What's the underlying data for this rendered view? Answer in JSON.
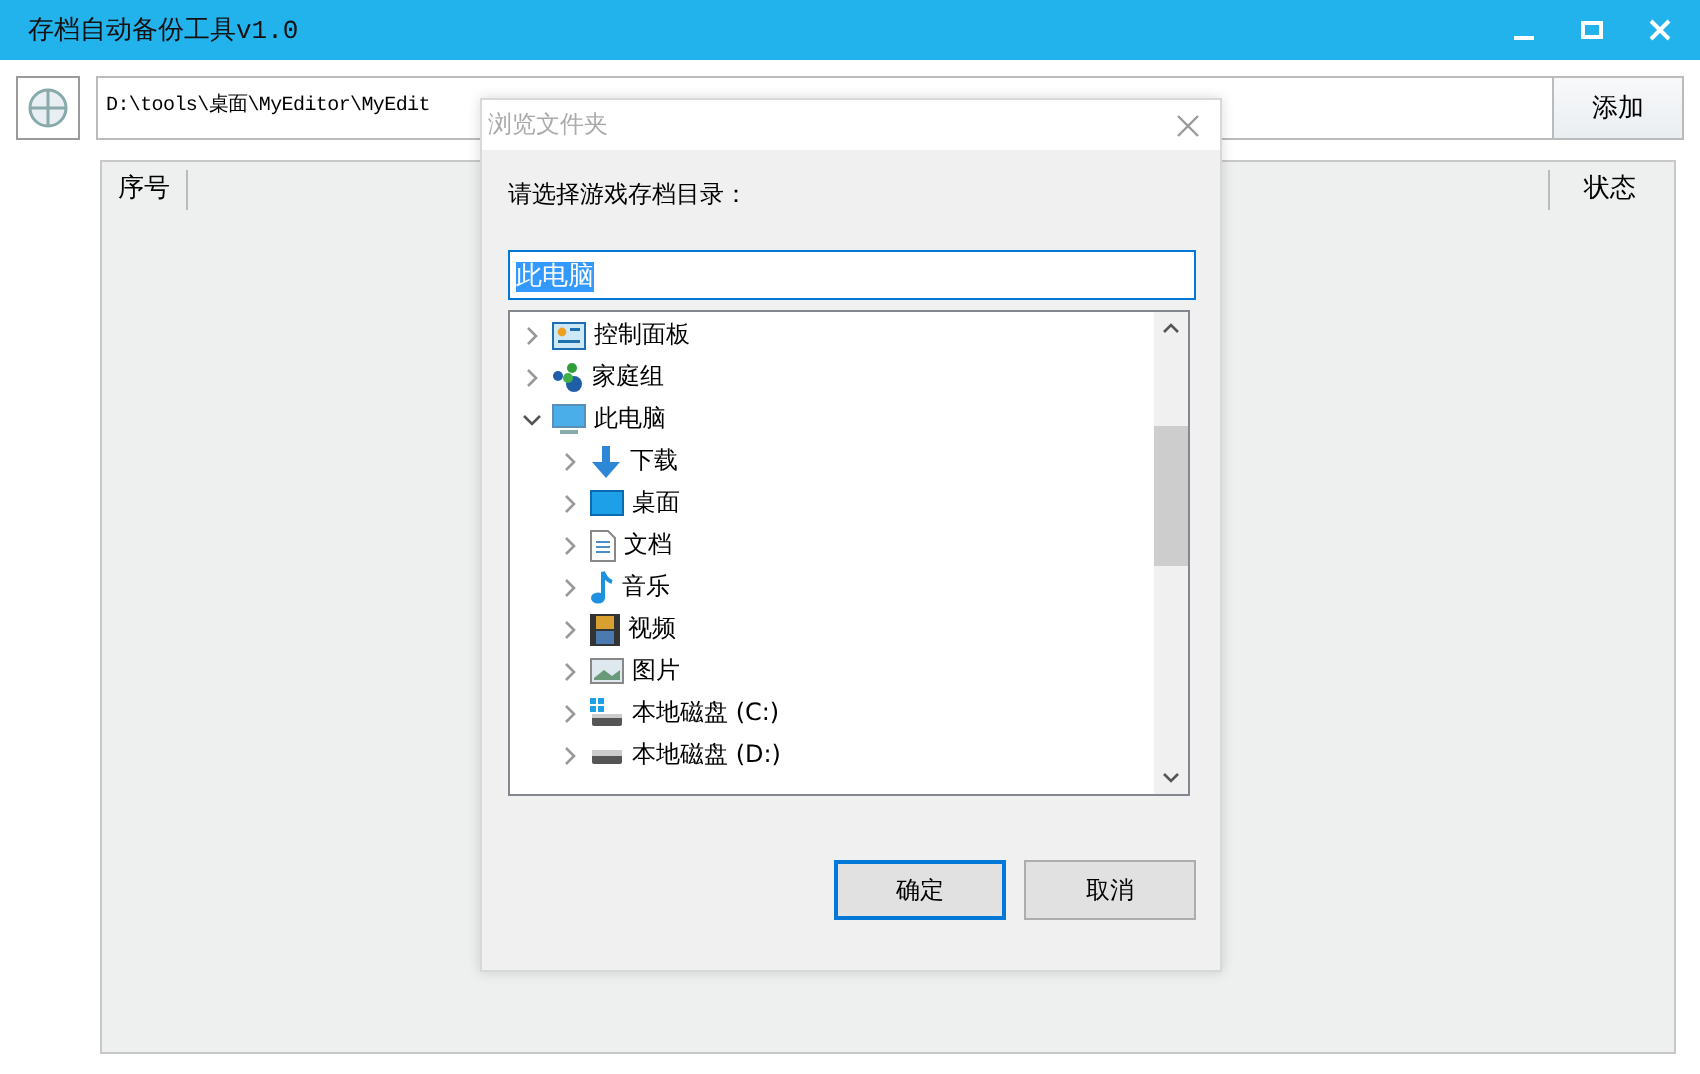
{
  "window": {
    "title": "存档自动备份工具v1.0"
  },
  "path_field": {
    "value": "D:\\tools\\桌面\\MyEditor\\MyEdit"
  },
  "add_button": "添加",
  "table": {
    "columns": [
      "序号",
      "状态"
    ]
  },
  "dialog": {
    "title": "浏览文件夹",
    "prompt": "请选择游戏存档目录：",
    "folder_field": {
      "value": "此电脑"
    },
    "tree": [
      {
        "label": "控制面板",
        "kind": "control-panel",
        "expanded": false
      },
      {
        "label": "家庭组",
        "kind": "homegroup",
        "expanded": false
      },
      {
        "label": "此电脑",
        "kind": "computer",
        "expanded": true,
        "children": [
          {
            "label": "下载",
            "kind": "download",
            "expanded": false
          },
          {
            "label": "桌面",
            "kind": "desktop",
            "expanded": false
          },
          {
            "label": "文档",
            "kind": "document",
            "expanded": false
          },
          {
            "label": "音乐",
            "kind": "music",
            "expanded": false
          },
          {
            "label": "视频",
            "kind": "video",
            "expanded": false
          },
          {
            "label": "图片",
            "kind": "image",
            "expanded": false
          },
          {
            "label": "本地磁盘 (C:)",
            "kind": "system-drive",
            "expanded": false
          },
          {
            "label": "本地磁盘 (D:)",
            "kind": "drive",
            "expanded": false
          }
        ]
      }
    ],
    "buttons": [
      {
        "label": "确定",
        "selected": true
      },
      {
        "label": "取消",
        "selected": false
      }
    ]
  }
}
